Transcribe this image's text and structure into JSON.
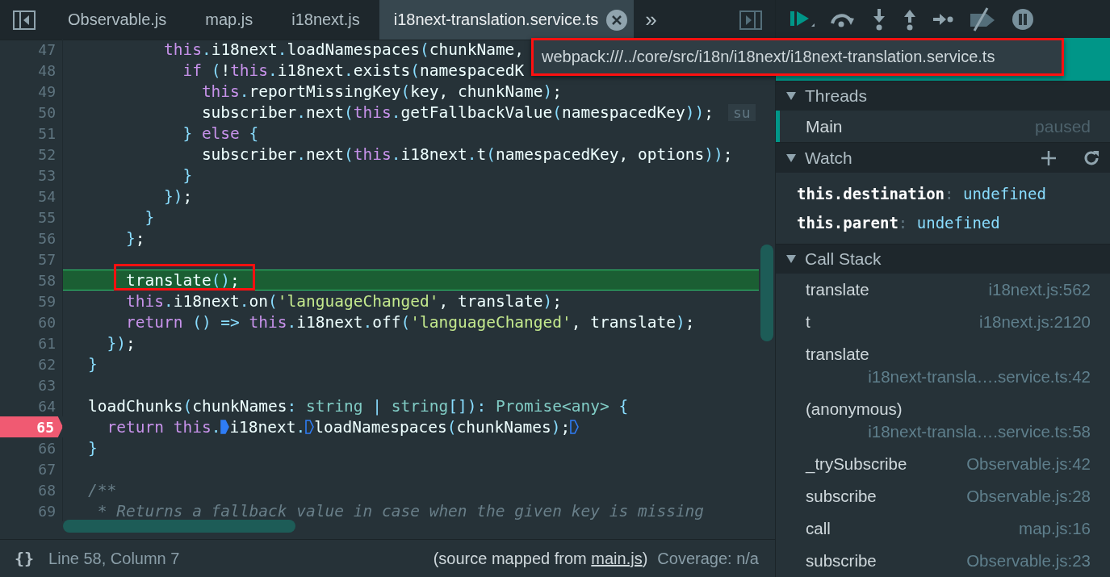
{
  "tabs": [
    {
      "label": "Observable.js",
      "selected": false
    },
    {
      "label": "map.js",
      "selected": false
    },
    {
      "label": "i18next.js",
      "selected": false
    },
    {
      "label": "i18next-translation.service.ts",
      "selected": true
    }
  ],
  "more_tabs": "»",
  "tooltip": "webpack:///../core/src/i18n/i18next/i18next-translation.service.ts",
  "code": {
    "lines": [
      {
        "number": "47",
        "tokens": [
          {
            "kind": "kw",
            "text": "        this"
          },
          {
            "kind": "p",
            "text": "."
          },
          {
            "kind": "n",
            "text": "i18next"
          },
          {
            "kind": "p",
            "text": "."
          },
          {
            "kind": "n",
            "text": "loadNamespaces"
          },
          {
            "kind": "p",
            "text": "("
          },
          {
            "kind": "n",
            "text": "chunkName,"
          }
        ]
      },
      {
        "number": "48",
        "tokens": [
          {
            "kind": "kw",
            "text": "          if"
          },
          {
            "kind": "p",
            "text": " ("
          },
          {
            "kind": "n",
            "text": "!"
          },
          {
            "kind": "kw",
            "text": "this"
          },
          {
            "kind": "p",
            "text": "."
          },
          {
            "kind": "n",
            "text": "i18next"
          },
          {
            "kind": "p",
            "text": "."
          },
          {
            "kind": "n",
            "text": "exists"
          },
          {
            "kind": "p",
            "text": "("
          },
          {
            "kind": "n",
            "text": "namespacedK"
          }
        ]
      },
      {
        "number": "49",
        "tokens": [
          {
            "kind": "kw",
            "text": "            this"
          },
          {
            "kind": "p",
            "text": "."
          },
          {
            "kind": "n",
            "text": "reportMissingKey"
          },
          {
            "kind": "p",
            "text": "("
          },
          {
            "kind": "n",
            "text": "key, chunkName"
          },
          {
            "kind": "p",
            "text": ")"
          },
          {
            "kind": "n",
            "text": ";"
          }
        ]
      },
      {
        "number": "50",
        "tokens": [
          {
            "kind": "n",
            "text": "            subscriber"
          },
          {
            "kind": "p",
            "text": "."
          },
          {
            "kind": "n",
            "text": "next"
          },
          {
            "kind": "p",
            "text": "("
          },
          {
            "kind": "kw",
            "text": "this"
          },
          {
            "kind": "p",
            "text": "."
          },
          {
            "kind": "n",
            "text": "getFallbackValue"
          },
          {
            "kind": "p",
            "text": "("
          },
          {
            "kind": "n",
            "text": "namespacedKey"
          },
          {
            "kind": "p",
            "text": "))"
          },
          {
            "kind": "n",
            "text": ";"
          },
          {
            "kind": "hint",
            "text": "su"
          }
        ]
      },
      {
        "number": "51",
        "tokens": [
          {
            "kind": "p",
            "text": "          }"
          },
          {
            "kind": "kw",
            "text": " else"
          },
          {
            "kind": "p",
            "text": " {"
          }
        ]
      },
      {
        "number": "52",
        "tokens": [
          {
            "kind": "n",
            "text": "            subscriber"
          },
          {
            "kind": "p",
            "text": "."
          },
          {
            "kind": "n",
            "text": "next"
          },
          {
            "kind": "p",
            "text": "("
          },
          {
            "kind": "kw",
            "text": "this"
          },
          {
            "kind": "p",
            "text": "."
          },
          {
            "kind": "n",
            "text": "i18next"
          },
          {
            "kind": "p",
            "text": "."
          },
          {
            "kind": "n",
            "text": "t"
          },
          {
            "kind": "p",
            "text": "("
          },
          {
            "kind": "n",
            "text": "namespacedKey, options"
          },
          {
            "kind": "p",
            "text": "))"
          },
          {
            "kind": "n",
            "text": ";"
          }
        ]
      },
      {
        "number": "53",
        "tokens": [
          {
            "kind": "p",
            "text": "          }"
          }
        ]
      },
      {
        "number": "54",
        "tokens": [
          {
            "kind": "p",
            "text": "        })"
          },
          {
            "kind": "n",
            "text": ";"
          }
        ]
      },
      {
        "number": "55",
        "tokens": [
          {
            "kind": "p",
            "text": "      }"
          }
        ]
      },
      {
        "number": "56",
        "tokens": [
          {
            "kind": "p",
            "text": "    }"
          },
          {
            "kind": "n",
            "text": ";"
          }
        ]
      },
      {
        "number": "57"
      },
      {
        "number": "58",
        "current": true,
        "tokens": [
          {
            "kind": "n",
            "text": "    translate"
          },
          {
            "kind": "p",
            "text": "()"
          },
          {
            "kind": "n",
            "text": ";"
          }
        ]
      },
      {
        "number": "59",
        "tokens": [
          {
            "kind": "kw",
            "text": "    this"
          },
          {
            "kind": "p",
            "text": "."
          },
          {
            "kind": "n",
            "text": "i18next"
          },
          {
            "kind": "p",
            "text": "."
          },
          {
            "kind": "n",
            "text": "on"
          },
          {
            "kind": "p",
            "text": "("
          },
          {
            "kind": "s",
            "text": "'languageChanged'"
          },
          {
            "kind": "n",
            "text": ", translate"
          },
          {
            "kind": "p",
            "text": ")"
          },
          {
            "kind": "n",
            "text": ";"
          }
        ]
      },
      {
        "number": "60",
        "tokens": [
          {
            "kind": "kw",
            "text": "    return"
          },
          {
            "kind": "p",
            "text": " () =>"
          },
          {
            "kind": "kw",
            "text": " this"
          },
          {
            "kind": "p",
            "text": "."
          },
          {
            "kind": "n",
            "text": "i18next"
          },
          {
            "kind": "p",
            "text": "."
          },
          {
            "kind": "n",
            "text": "off"
          },
          {
            "kind": "p",
            "text": "("
          },
          {
            "kind": "s",
            "text": "'languageChanged'"
          },
          {
            "kind": "n",
            "text": ", translate"
          },
          {
            "kind": "p",
            "text": ")"
          },
          {
            "kind": "n",
            "text": ";"
          }
        ]
      },
      {
        "number": "61",
        "tokens": [
          {
            "kind": "p",
            "text": "  })"
          },
          {
            "kind": "n",
            "text": ";"
          }
        ]
      },
      {
        "number": "62",
        "tokens": [
          {
            "kind": "p",
            "text": "}"
          }
        ]
      },
      {
        "number": "63"
      },
      {
        "number": "64",
        "tokens": [
          {
            "kind": "n",
            "text": "loadChunks"
          },
          {
            "kind": "p",
            "text": "("
          },
          {
            "kind": "n",
            "text": "chunkNames"
          },
          {
            "kind": "p",
            "text": ":"
          },
          {
            "kind": "t",
            "text": " string"
          },
          {
            "kind": "p",
            "text": " |"
          },
          {
            "kind": "t",
            "text": " string"
          },
          {
            "kind": "p",
            "text": "[])"
          },
          {
            "kind": "p",
            "text": ":"
          },
          {
            "kind": "t",
            "text": " Promise<any>"
          },
          {
            "kind": "p",
            "text": " {"
          }
        ]
      },
      {
        "number": "65",
        "breakpoint": true,
        "tokens": [
          {
            "kind": "kw",
            "text": "  return"
          },
          {
            "kind": "kw",
            "text": " this"
          },
          {
            "kind": "p",
            "text": "."
          },
          {
            "kind": "marker",
            "active": true
          },
          {
            "kind": "n",
            "text": "i18next"
          },
          {
            "kind": "p",
            "text": "."
          },
          {
            "kind": "marker",
            "active": false
          },
          {
            "kind": "n",
            "text": "loadNamespaces"
          },
          {
            "kind": "p",
            "text": "("
          },
          {
            "kind": "n",
            "text": "chunkNames"
          },
          {
            "kind": "p",
            "text": ")"
          },
          {
            "kind": "n",
            "text": ";"
          },
          {
            "kind": "marker",
            "active": false
          }
        ]
      },
      {
        "number": "66",
        "tokens": [
          {
            "kind": "p",
            "text": "}"
          }
        ]
      },
      {
        "number": "67"
      },
      {
        "number": "68",
        "tokens": [
          {
            "kind": "c",
            "text": "/**"
          }
        ]
      },
      {
        "number": "69",
        "tokens": [
          {
            "kind": "c",
            "text": " * Returns a fallback value in case when the given key is missing"
          }
        ]
      }
    ]
  },
  "status_bar": {
    "format_button": "{}",
    "position": "Line 58, Column 7",
    "source_prefix": "(source mapped from ",
    "source_link": "main.js",
    "source_suffix": ")",
    "coverage": "Coverage: n/a"
  },
  "threads": {
    "title": "Threads",
    "items": [
      {
        "name": "Main",
        "status": "paused",
        "selected": true
      }
    ]
  },
  "watch": {
    "title": "Watch",
    "items": [
      {
        "expression": "this.destination",
        "separator": ":",
        "value": "undefined"
      },
      {
        "expression": "this.parent",
        "separator": ":",
        "value": "undefined"
      }
    ]
  },
  "call_stack": {
    "title": "Call Stack",
    "frames": [
      {
        "name": "translate",
        "location": "i18next.js:562"
      },
      {
        "name": "t",
        "location": "i18next.js:2120"
      },
      {
        "name": "translate",
        "location": "i18next-transla….service.ts:42"
      },
      {
        "name": "(anonymous)",
        "location": "i18next-transla….service.ts:58"
      },
      {
        "name": "_trySubscribe",
        "location": "Observable.js:42"
      },
      {
        "name": "subscribe",
        "location": "Observable.js:28"
      },
      {
        "name": "call",
        "location": "map.js:16"
      },
      {
        "name": "subscribe",
        "location": "Observable.js:23"
      }
    ]
  }
}
